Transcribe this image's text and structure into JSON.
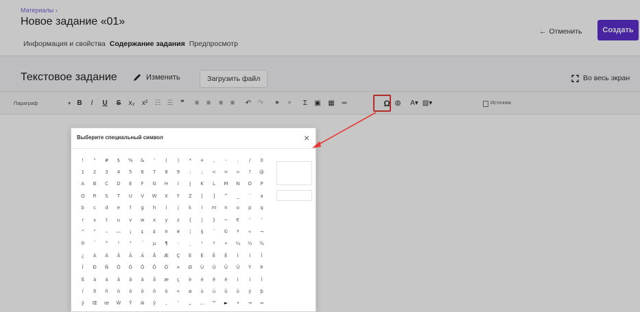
{
  "header": {
    "breadcrumb": "Материалы ›",
    "title": "Новое задание «01»",
    "tabs": [
      {
        "label": "Информация и свойства"
      },
      {
        "label": "Содержание задания"
      },
      {
        "label": "Предпросмотр"
      }
    ],
    "cancel_label": "Отменить",
    "create_label": "Создать"
  },
  "content": {
    "section_title": "Текстовое задание",
    "edit_label": "Изменить",
    "upload_label": "Загрузить файл",
    "fullscreen_label": "Во весь экран"
  },
  "toolbar": {
    "paragraph_label": "Параграф",
    "source_label": "Источник",
    "buttons": [
      {
        "icon": "bold-icon",
        "glyph": "B"
      },
      {
        "icon": "italic-icon",
        "glyph": "I"
      },
      {
        "icon": "underline-icon",
        "glyph": "U"
      },
      {
        "icon": "strikethrough-icon",
        "glyph": "S"
      },
      {
        "icon": "subscript-icon",
        "glyph": "x₂"
      },
      {
        "icon": "superscript-icon",
        "glyph": "x²"
      },
      {
        "icon": "numbered-list-icon",
        "glyph": "☷"
      },
      {
        "icon": "bulleted-list-icon",
        "glyph": "☰"
      },
      {
        "icon": "blockquote-icon",
        "glyph": "❞"
      },
      {
        "icon": "align-left-icon",
        "glyph": "≡"
      },
      {
        "icon": "align-center-icon",
        "glyph": "≡"
      },
      {
        "icon": "align-right-icon",
        "glyph": "≡"
      },
      {
        "icon": "align-justify-icon",
        "glyph": "≡"
      },
      {
        "icon": "undo-icon",
        "glyph": "↶"
      },
      {
        "icon": "redo-icon",
        "glyph": "↷"
      },
      {
        "icon": "link-icon",
        "glyph": "⚭"
      },
      {
        "icon": "unlink-icon",
        "glyph": "⚭"
      },
      {
        "icon": "formula-icon",
        "glyph": "Σ"
      },
      {
        "icon": "image-icon",
        "glyph": "▣"
      },
      {
        "icon": "table-icon",
        "glyph": "▦"
      },
      {
        "icon": "horizontal-line-icon",
        "glyph": "═"
      },
      {
        "icon": "special-char-icon",
        "glyph": "Ω"
      },
      {
        "icon": "globe-icon",
        "glyph": "◍"
      },
      {
        "icon": "text-color-icon",
        "glyph": "A▾"
      },
      {
        "icon": "background-color-icon",
        "glyph": "▧▾"
      }
    ]
  },
  "dialog": {
    "title": "Выберите специальный символ",
    "rows": [
      [
        "!",
        "\"",
        "#",
        "$",
        "%",
        "&",
        "'",
        "(",
        ")",
        "*",
        "+",
        ",",
        "-",
        ".",
        "/",
        "0",
        "1",
        "2"
      ],
      [
        "3",
        "4",
        "5",
        "6",
        "7",
        "8",
        "9",
        ":",
        ";",
        "<",
        "=",
        ">",
        "?",
        "@",
        "A",
        "B",
        "C"
      ],
      [
        "D",
        "E",
        "F",
        "G",
        "H",
        "I",
        "J",
        "K",
        "L",
        "M",
        "N",
        "O",
        "P",
        "Q",
        "R",
        "S",
        "T"
      ],
      [
        "U",
        "V",
        "W",
        "X",
        "Y",
        "Z",
        "[",
        "]",
        "^",
        "_",
        "`",
        "a",
        "b",
        "c",
        "d",
        "e",
        "f"
      ],
      [
        "g",
        "h",
        "i",
        "j",
        "k",
        "l",
        "m",
        "n",
        "o",
        "p",
        "q",
        "r",
        "s",
        "t",
        "u",
        "v",
        "w"
      ],
      [
        "x",
        "y",
        "z",
        "{",
        "|",
        "}",
        "~",
        "€",
        "‘",
        "’",
        "“",
        "”",
        "–",
        "—",
        "¡",
        "¢",
        "£"
      ],
      [
        "¤",
        "¥",
        "¦",
        "§",
        "¨",
        "©",
        "ª",
        "«",
        "¬",
        "®",
        "¯",
        "°",
        "²",
        "³",
        "´",
        "µ",
        "¶"
      ],
      [
        "·",
        "¸",
        "¹",
        "º",
        "»",
        "¼",
        "½",
        "¾",
        "¿",
        "À",
        "Á",
        "Â",
        "Ã",
        "Ä",
        "Å",
        "Æ",
        "Ç"
      ],
      [
        "È",
        "É",
        "Ê",
        "Ë",
        "Ì",
        "Í",
        "Î",
        "Ï",
        "Ð",
        "Ñ",
        "Ò",
        "Ó",
        "Ô",
        "Õ",
        "Ö",
        "×",
        "Ø"
      ],
      [
        "Ù",
        "Ú",
        "Û",
        "Ü",
        "Ý",
        "Þ",
        "ß",
        "à",
        "á",
        "â",
        "ã",
        "ä",
        "å",
        "æ",
        "ç",
        "è",
        "é"
      ],
      [
        "ê",
        "ë",
        "ì",
        "í",
        "î",
        "ï",
        "ð",
        "ñ",
        "ò",
        "ó",
        "ô",
        "õ",
        "ö",
        "÷",
        "ø",
        "ù",
        "ú"
      ],
      [
        "û",
        "ü",
        "ý",
        "þ",
        "ÿ",
        "Œ",
        "œ",
        "Ŵ",
        "Ŷ",
        "ŵ",
        "ŷ",
        "‚",
        "‛",
        "„",
        "…",
        "™",
        "►"
      ],
      [
        "•",
        "→",
        "⇒",
        "⇔",
        "♦",
        "≈"
      ]
    ]
  },
  "colors": {
    "accent": "#5d2fd0",
    "breadcrumb": "#7b5fd6",
    "highlight": "#e53935"
  }
}
